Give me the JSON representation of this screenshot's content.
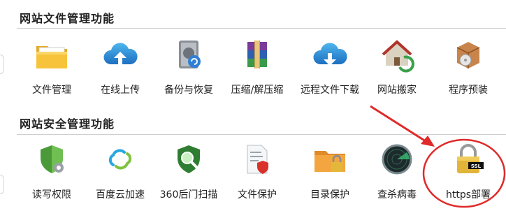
{
  "sections": [
    {
      "title": "网站文件管理功能",
      "items": [
        {
          "label": "文件管理",
          "icon": "folder-icon"
        },
        {
          "label": "在线上传",
          "icon": "cloud-upload-icon"
        },
        {
          "label": "备份与恢复",
          "icon": "hard-drive-backup-icon"
        },
        {
          "label": "压缩/解压缩",
          "icon": "archive-books-icon"
        },
        {
          "label": "远程文件下载",
          "icon": "cloud-download-icon"
        },
        {
          "label": "网站搬家",
          "icon": "house-move-icon"
        },
        {
          "label": "程序预装",
          "icon": "software-box-icon"
        }
      ]
    },
    {
      "title": "网站安全管理功能",
      "items": [
        {
          "label": "读写权限",
          "icon": "shield-gear-icon"
        },
        {
          "label": "百度云加速",
          "icon": "cloud-link-icon"
        },
        {
          "label": "360后门扫描",
          "icon": "shield-magnifier-icon"
        },
        {
          "label": "文件保护",
          "icon": "document-shield-icon"
        },
        {
          "label": "目录保护",
          "icon": "folder-lock-icon"
        },
        {
          "label": "查杀病毒",
          "icon": "radar-scan-icon"
        },
        {
          "label": "https部署",
          "icon": "ssl-padlock-icon"
        }
      ]
    }
  ],
  "annotation": {
    "color": "#e02a2a",
    "target_label": "https部署"
  },
  "colors": {
    "accent_red": "#e02a2a",
    "divider": "#cfcfcf"
  }
}
